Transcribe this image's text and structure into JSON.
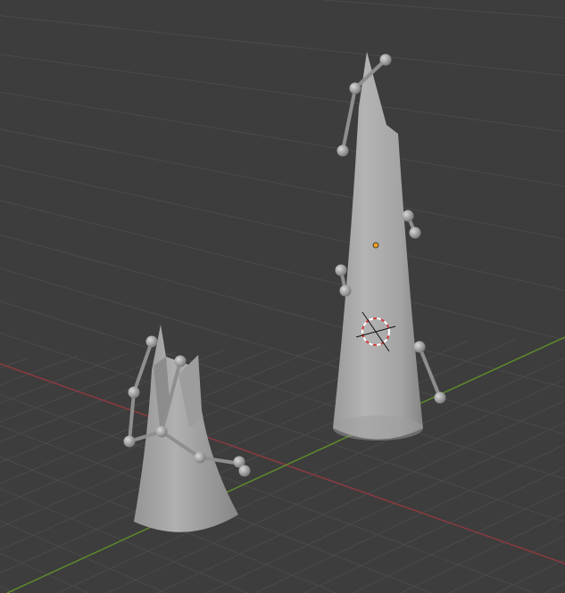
{
  "viewport": {
    "background_color": "#3d3d3d",
    "grid_color": "#4a4a4a",
    "x_axis_color": "#8c3a3f",
    "y_axis_color": "#5e8a2c",
    "mesh_color": "#a8a8a8",
    "bone_color": "#9a9a9a",
    "origin_color": "#f0a020",
    "cursor_color": "#d04040"
  }
}
